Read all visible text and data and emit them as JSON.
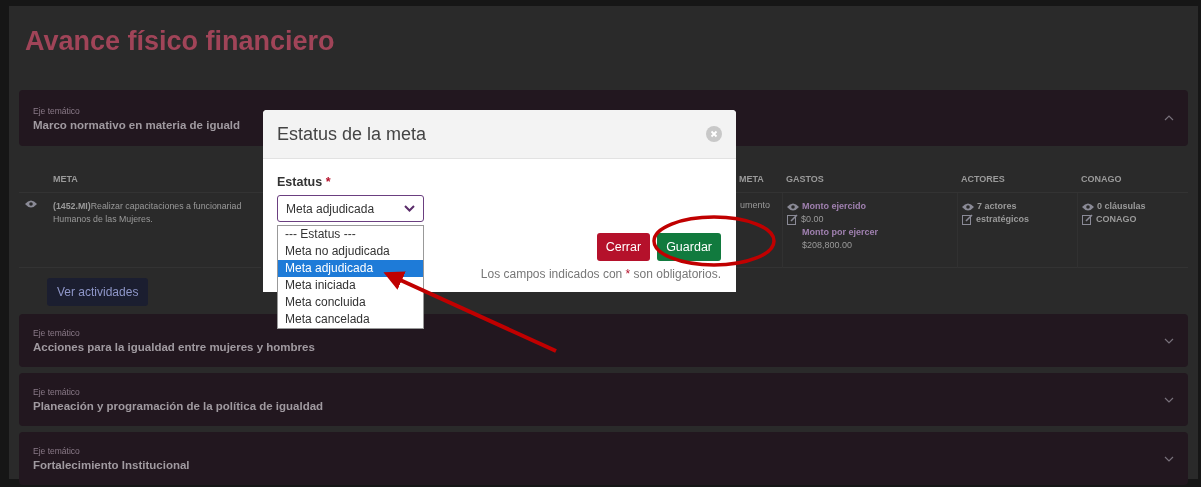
{
  "page": {
    "title": "Avance físico financiero"
  },
  "ejes": [
    {
      "label": "Eje temático",
      "title": "Marco normativo en materia de iguald",
      "expanded": true
    },
    {
      "label": "Eje temático",
      "title": "Acciones para la igualdad entre mujeres y hombres",
      "expanded": false
    },
    {
      "label": "Eje temático",
      "title": "Planeación y programación de la política de igualdad",
      "expanded": false
    },
    {
      "label": "Eje temático",
      "title": "Fortalecimiento Institucional",
      "expanded": false
    }
  ],
  "table": {
    "columns": [
      "META",
      "META",
      "GASTOS",
      "ACTORES",
      "CONAGO"
    ],
    "row": {
      "meta": [
        "**(1452.MI)**Realizar capacitaciones a funcionariad",
        "Humanos de las Mujeres."
      ],
      "column_2": "umento",
      "gastos": [
        {
          "text": "Monto ejercido",
          "kind": "label"
        },
        {
          "text": "$0.00",
          "kind": "value"
        },
        {
          "text": "Monto por ejercer",
          "kind": "label"
        },
        {
          "text": "$208,800.00",
          "kind": "value"
        }
      ],
      "actores": [
        "7 actores",
        "estratégicos"
      ],
      "conago": [
        "0 cláusulas",
        "CONAGO"
      ]
    },
    "button": "Ver actividades"
  },
  "modal": {
    "title": "Estatus de la meta",
    "field": {
      "label": "Estatus",
      "required_mark": "*",
      "value": "Meta adjudicada",
      "options": [
        {
          "label": "--- Estatus ---",
          "selected": false
        },
        {
          "label": "Meta no adjudicada",
          "selected": false
        },
        {
          "label": "Meta adjudicada",
          "selected": true
        },
        {
          "label": "Meta iniciada",
          "selected": false
        },
        {
          "label": "Meta concluida",
          "selected": false
        },
        {
          "label": "Meta cancelada",
          "selected": false
        }
      ]
    },
    "buttons": [
      {
        "label": "Cerrar",
        "kind": "danger"
      },
      {
        "label": "Guardar",
        "kind": "primary"
      }
    ],
    "note": {
      "before": "Los campos indicados con",
      "mark": "*",
      "after": "son obligatorios."
    }
  }
}
